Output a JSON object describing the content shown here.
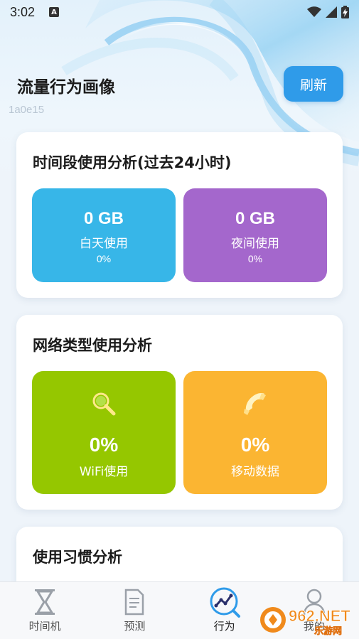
{
  "status_bar": {
    "time": "3:02",
    "notification_icon": "a-badge-icon",
    "wifi_icon": "wifi-icon",
    "signal_icon": "signal-icon",
    "battery_icon": "battery-charging-icon"
  },
  "header": {
    "title": "流量行为画像",
    "subtitle": "1a0e15",
    "refresh_label": "刷新"
  },
  "time_card": {
    "title": "时间段使用分析(过去24小时)",
    "tiles": [
      {
        "value": "0 GB",
        "label": "白天使用",
        "pct": "0%",
        "color": "#37b6e8"
      },
      {
        "value": "0 GB",
        "label": "夜间使用",
        "pct": "0%",
        "color": "#a467cc"
      }
    ]
  },
  "network_card": {
    "title": "网络类型使用分析",
    "tiles": [
      {
        "icon": "search-icon",
        "value": "0%",
        "label": "WiFi使用",
        "color": "#95c700"
      },
      {
        "icon": "phone-icon",
        "value": "0%",
        "label": "移动数据",
        "color": "#fbb532"
      }
    ]
  },
  "habit_card": {
    "title": "使用习惯分析"
  },
  "bottom_nav": [
    {
      "icon": "hourglass-icon",
      "label": "时间机"
    },
    {
      "icon": "document-icon",
      "label": "预测"
    },
    {
      "icon": "trend-chart-icon",
      "label": "行为",
      "active": true
    },
    {
      "icon": "person-icon",
      "label": "我的"
    }
  ],
  "watermark": {
    "text": "962.NET",
    "subtext": "乐游网"
  }
}
